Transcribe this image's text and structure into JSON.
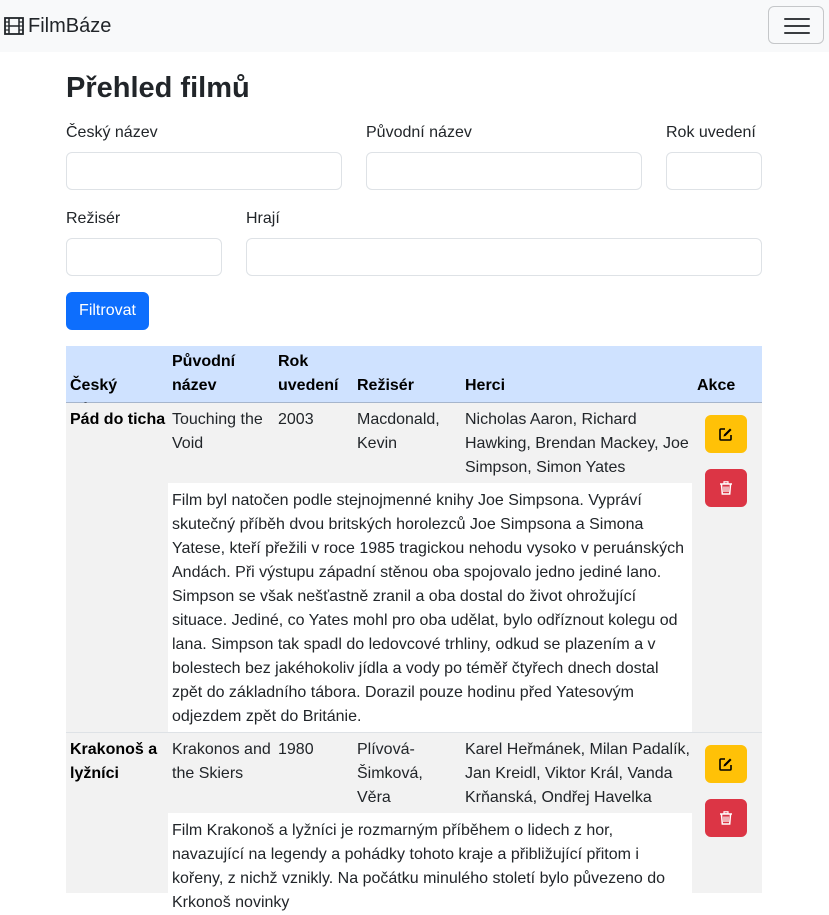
{
  "navbar": {
    "brand": "FilmBáze",
    "brand_icon": "film-icon",
    "menu_icon": "hamburger-icon"
  },
  "page": {
    "title": "Přehled filmů"
  },
  "filter": {
    "fields": [
      {
        "label": "Český název",
        "value": ""
      },
      {
        "label": "Původní název",
        "value": ""
      },
      {
        "label": "Rok uvedení",
        "value": ""
      },
      {
        "label": "Režisér",
        "value": ""
      },
      {
        "label": "Hrají",
        "value": ""
      }
    ],
    "submit_label": "Filtrovat"
  },
  "table": {
    "header": {
      "czech_title": "Český název",
      "original_title": "Původní název",
      "year": "Rok uvedení",
      "director": "Režisér",
      "actors": "Herci",
      "actions": "Akce"
    },
    "rows": [
      {
        "czech_title": "Pád do ticha",
        "original_title": "Touching the Void",
        "year": "2003",
        "director": "Macdonald, Kevin",
        "actors": "Nicholas Aaron, Richard Hawking, Brendan Mackey, Joe Simpson, Simon Yates",
        "description": "Film byl natočen podle stejnojmenné knihy Joe Simpsona. Vypráví skutečný příběh dvou britských horolezců Joe Simpsona a Simona Yatese, kteří přežili v roce 1985 tragickou nehodu vysoko v peruánských Andách. Při výstupu západní stěnou oba spojovalo jedno jediné lano. Simpson se však nešťastně zranil a oba dostal do život ohrožující situace. Jediné, co Yates mohl pro oba udělat, bylo odříznout kolegu od lana. Simpson tak spadl do ledovcové trhliny, odkud se plazením a v bolestech bez jakéhokoliv jídla a vody po téměř čtyřech dnech dostal zpět do základního tábora. Dorazil pouze hodinu před Yatesovým odjezdem zpět do Británie."
      },
      {
        "czech_title": "Krakonoš a lyžníci",
        "original_title": "Krakonos and the Skiers",
        "year": "1980",
        "director": "Plívová-Šimková, Věra",
        "actors": "Karel Heřmánek, Milan Padalík, Jan Kreidl, Viktor Král, Vanda Krňanská, Ondřej Havelka",
        "description": "Film Krakonoš a lyžníci je rozmarným příběhem o lidech z hor, navazující na legendy a pohádky tohoto kraje a přibližující přitom i kořeny, z nichž vznikly. Na počátku minulého století bylo půvezeno do Krkonoš novinky"
      }
    ],
    "edit_icon": "pencil-square-icon",
    "delete_icon": "trash-icon"
  },
  "colors": {
    "primary": "#0d6efd",
    "warning": "#ffc107",
    "danger": "#dc3545",
    "table_header": "#cfe2ff",
    "row_stripe": "#f2f2f2",
    "navbar_bg": "#f8f9fa"
  }
}
